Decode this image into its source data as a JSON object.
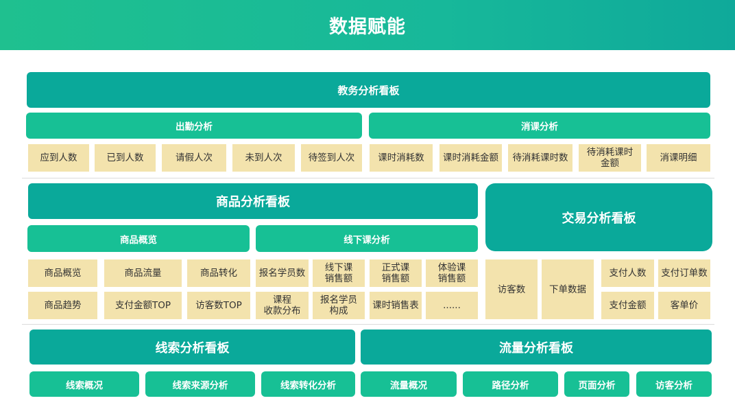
{
  "title": "数据赋能",
  "edu": {
    "title": "教务分析看板",
    "attendance": {
      "title": "出勤分析",
      "items": [
        "应到人数",
        "已到人数",
        "请假人次",
        "未到人次",
        "待签到人次"
      ]
    },
    "consume": {
      "title": "消课分析",
      "items": [
        "课时消耗数",
        "课时消耗金额",
        "待消耗课时数",
        "待消耗课时\n金额",
        "消课明细"
      ]
    }
  },
  "goods": {
    "title": "商品分析看板",
    "overview": {
      "title": "商品概览",
      "items": [
        "商品概览",
        "商品流量",
        "商品转化",
        "商品趋势",
        "支付金额TOP",
        "访客数TOP"
      ]
    },
    "offline": {
      "title": "线下课分析",
      "items": [
        "报名学员数",
        "线下课\n销售额",
        "正式课\n销售额",
        "体验课\n销售额",
        "课程\n收款分布",
        "报名学员\n构成",
        "课时销售表",
        "......"
      ]
    }
  },
  "trade": {
    "title": "交易分析看板",
    "items": [
      "访客数",
      "下单数据",
      "支付人数",
      "支付订单数",
      "支付金额",
      "客单价"
    ]
  },
  "clue": {
    "title": "线索分析看板",
    "items": [
      "线索概况",
      "线索来源分析",
      "线索转化分析"
    ]
  },
  "traffic": {
    "title": "流量分析看板",
    "items": [
      "流量概况",
      "路径分析",
      "页面分析",
      "访客分析"
    ]
  }
}
